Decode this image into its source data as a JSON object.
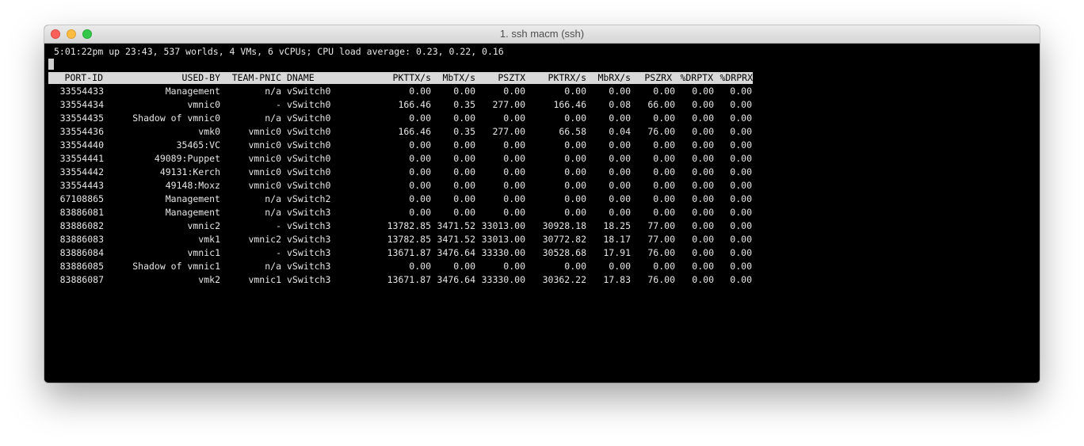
{
  "window": {
    "title": "1. ssh macm (ssh)"
  },
  "terminal": {
    "status_line": "5:01:22pm up 23:43, 537 worlds, 4 VMs, 6 vCPUs; CPU load average: 0.23, 0.22, 0.16",
    "columns": [
      "PORT-ID",
      "USED-BY",
      "TEAM-PNIC",
      "DNAME",
      "PKTTX/s",
      "MbTX/s",
      "PSZTX",
      "PKTRX/s",
      "MbRX/s",
      "PSZRX",
      "%DRPTX",
      "%DRPRX"
    ],
    "rows": [
      [
        "33554433",
        "Management",
        "n/a",
        "vSwitch0",
        "0.00",
        "0.00",
        "0.00",
        "0.00",
        "0.00",
        "0.00",
        "0.00",
        "0.00"
      ],
      [
        "33554434",
        "vmnic0",
        "-",
        "vSwitch0",
        "166.46",
        "0.35",
        "277.00",
        "166.46",
        "0.08",
        "66.00",
        "0.00",
        "0.00"
      ],
      [
        "33554435",
        "Shadow of vmnic0",
        "n/a",
        "vSwitch0",
        "0.00",
        "0.00",
        "0.00",
        "0.00",
        "0.00",
        "0.00",
        "0.00",
        "0.00"
      ],
      [
        "33554436",
        "vmk0",
        "vmnic0",
        "vSwitch0",
        "166.46",
        "0.35",
        "277.00",
        "66.58",
        "0.04",
        "76.00",
        "0.00",
        "0.00"
      ],
      [
        "33554440",
        "35465:VC",
        "vmnic0",
        "vSwitch0",
        "0.00",
        "0.00",
        "0.00",
        "0.00",
        "0.00",
        "0.00",
        "0.00",
        "0.00"
      ],
      [
        "33554441",
        "49089:Puppet",
        "vmnic0",
        "vSwitch0",
        "0.00",
        "0.00",
        "0.00",
        "0.00",
        "0.00",
        "0.00",
        "0.00",
        "0.00"
      ],
      [
        "33554442",
        "49131:Kerch",
        "vmnic0",
        "vSwitch0",
        "0.00",
        "0.00",
        "0.00",
        "0.00",
        "0.00",
        "0.00",
        "0.00",
        "0.00"
      ],
      [
        "33554443",
        "49148:Moxz",
        "vmnic0",
        "vSwitch0",
        "0.00",
        "0.00",
        "0.00",
        "0.00",
        "0.00",
        "0.00",
        "0.00",
        "0.00"
      ],
      [
        "67108865",
        "Management",
        "n/a",
        "vSwitch2",
        "0.00",
        "0.00",
        "0.00",
        "0.00",
        "0.00",
        "0.00",
        "0.00",
        "0.00"
      ],
      [
        "83886081",
        "Management",
        "n/a",
        "vSwitch3",
        "0.00",
        "0.00",
        "0.00",
        "0.00",
        "0.00",
        "0.00",
        "0.00",
        "0.00"
      ],
      [
        "83886082",
        "vmnic2",
        "-",
        "vSwitch3",
        "13782.85",
        "3471.52",
        "33013.00",
        "30928.18",
        "18.25",
        "77.00",
        "0.00",
        "0.00"
      ],
      [
        "83886083",
        "vmk1",
        "vmnic2",
        "vSwitch3",
        "13782.85",
        "3471.52",
        "33013.00",
        "30772.82",
        "18.17",
        "77.00",
        "0.00",
        "0.00"
      ],
      [
        "83886084",
        "vmnic1",
        "-",
        "vSwitch3",
        "13671.87",
        "3476.64",
        "33330.00",
        "30528.68",
        "17.91",
        "76.00",
        "0.00",
        "0.00"
      ],
      [
        "83886085",
        "Shadow of vmnic1",
        "n/a",
        "vSwitch3",
        "0.00",
        "0.00",
        "0.00",
        "0.00",
        "0.00",
        "0.00",
        "0.00",
        "0.00"
      ],
      [
        "83886087",
        "vmk2",
        "vmnic1",
        "vSwitch3",
        "13671.87",
        "3476.64",
        "33330.00",
        "30362.22",
        "17.83",
        "76.00",
        "0.00",
        "0.00"
      ]
    ]
  },
  "colors": {
    "terminal_bg": "#000000",
    "terminal_fg": "#e6e6e6",
    "header_bg": "#d9d9d9",
    "close": "#fc605b",
    "minimize": "#fdbc40",
    "zoom": "#34c84a"
  }
}
